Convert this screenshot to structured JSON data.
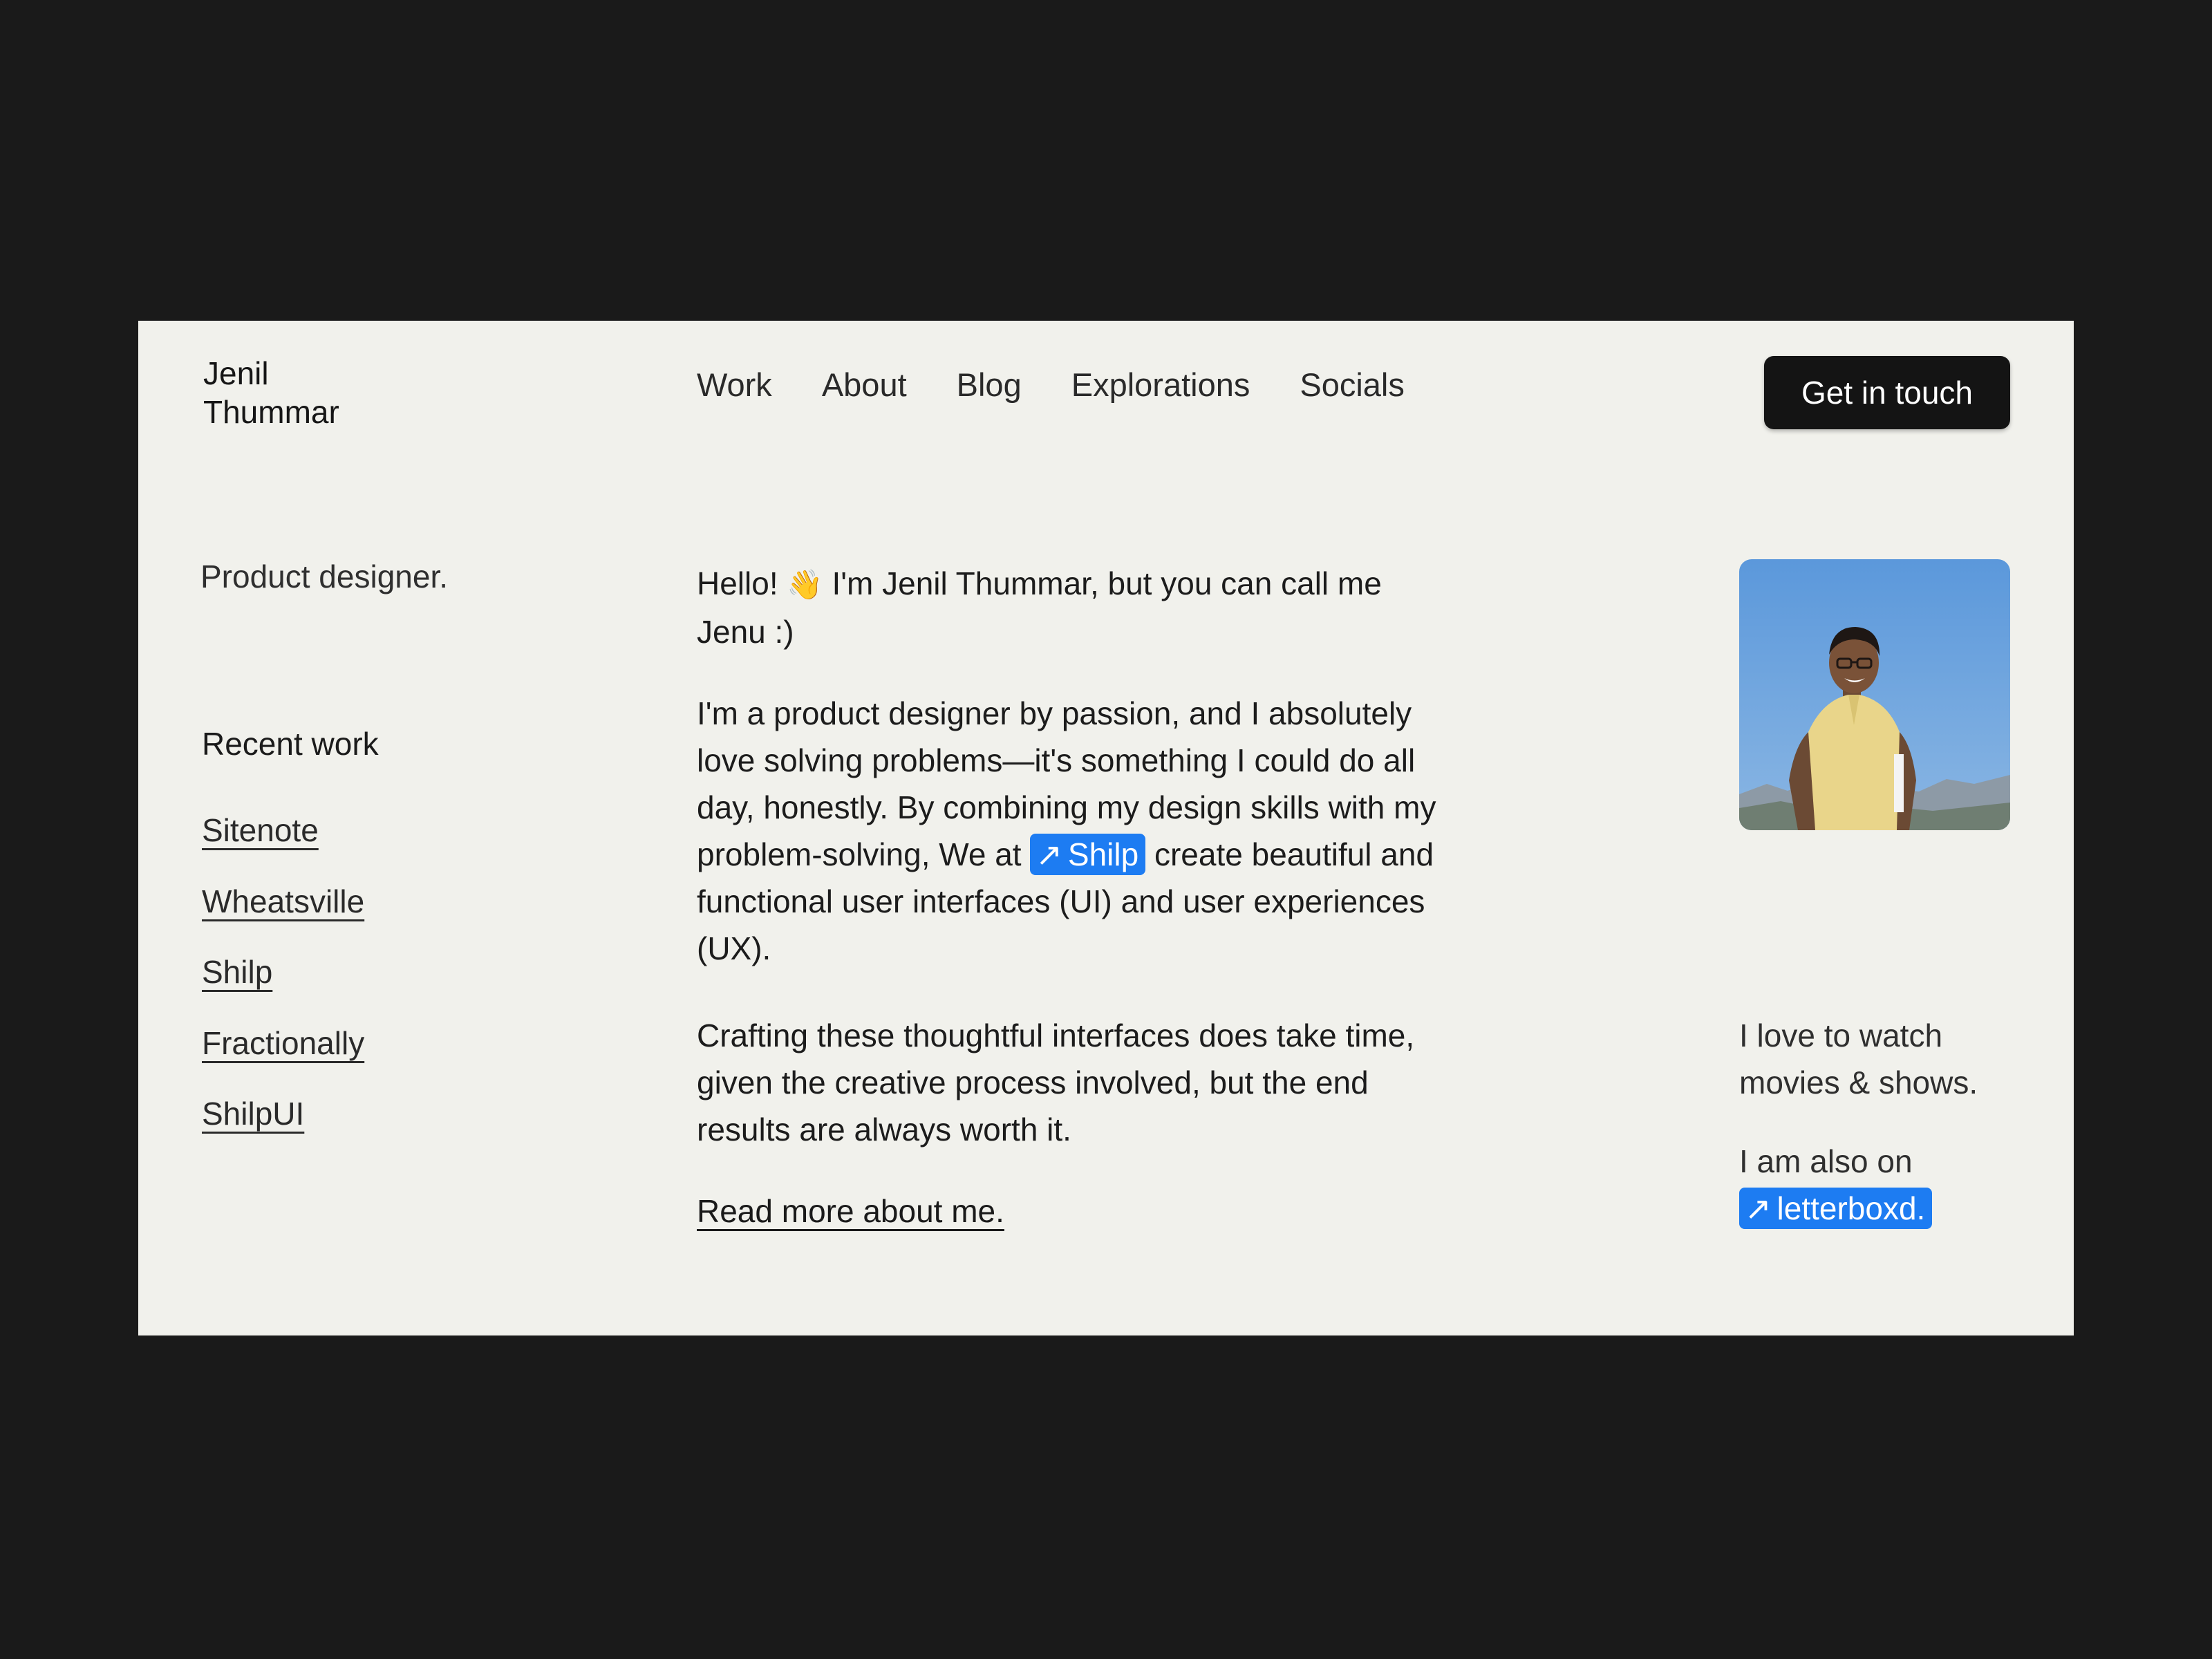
{
  "header": {
    "brand_line1": "Jenil",
    "brand_line2": "Thummar",
    "nav": [
      {
        "label": "Work"
      },
      {
        "label": "About"
      },
      {
        "label": "Blog"
      },
      {
        "label": "Explorations"
      },
      {
        "label": "Socials"
      }
    ],
    "cta_label": "Get in touch"
  },
  "sidebar": {
    "tagline": "Product designer.",
    "recent_heading": "Recent work",
    "work": [
      {
        "label": "Sitenote"
      },
      {
        "label": "Wheatsville"
      },
      {
        "label": "Shilp"
      },
      {
        "label": "Fractionally"
      },
      {
        "label": "ShilpUI"
      }
    ]
  },
  "intro": {
    "hello_prefix": "Hello!",
    "wave_emoji": "👋",
    "hello_rest": "I'm Jenil Thummar, but you can call me Jenu :)",
    "passion_before": "I'm a product designer by passion, and I absolutely love solving problems—it's something I could do all day, honestly. By combining my design skills with my problem-solving, We at",
    "shilp_arrow": "↗",
    "shilp_label": "Shilp",
    "passion_after": "create beautiful and functional user interfaces (UI) and user experiences (UX).",
    "crafting": "Crafting these thoughtful interfaces does take time, given the creative process involved, but the end results are always worth it.",
    "read_more": "Read more about me."
  },
  "aside": {
    "watch_text": "I love to watch movies & shows.",
    "also_on": "I am also on",
    "letterboxd_arrow": "↗",
    "letterboxd_label": "letterboxd."
  },
  "colors": {
    "page_background": "#1a1a1a",
    "card_background": "#f1f1ec",
    "accent_chip": "#1d7cf2",
    "button_background": "#141414"
  }
}
